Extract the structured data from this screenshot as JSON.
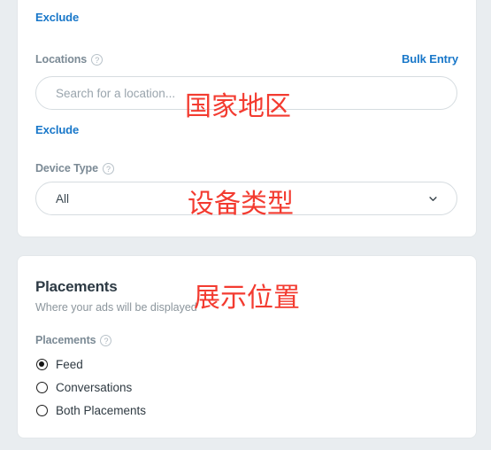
{
  "page": {
    "background_color": "#e9edf0",
    "card_background": "#ffffff",
    "link_color": "#1877c9",
    "annotation_color": "#f33b30"
  },
  "targeting_card": {
    "exclude_audiences_label": "Exclude",
    "locations": {
      "label": "Locations",
      "help_icon": "help-circle-icon",
      "bulk_entry_label": "Bulk Entry",
      "search_placeholder": "Search for a location...",
      "search_value": "",
      "exclude_label": "Exclude"
    },
    "device_type": {
      "label": "Device Type",
      "help_icon": "help-circle-icon",
      "selected": "All",
      "options": [
        "All"
      ],
      "chevron_icon": "chevron-down-icon"
    }
  },
  "placements_card": {
    "title": "Placements",
    "subtitle": "Where your ads will be displayed",
    "field_label": "Placements",
    "help_icon": "help-circle-icon",
    "options": [
      {
        "label": "Feed",
        "selected": true
      },
      {
        "label": "Conversations",
        "selected": false
      },
      {
        "label": "Both Placements",
        "selected": false
      }
    ]
  },
  "annotations": [
    {
      "text": "国家地区",
      "target": "locations-search-input"
    },
    {
      "text": "设备类型",
      "target": "device-type-select"
    },
    {
      "text": "展示位置",
      "target": "placements-section-title"
    }
  ]
}
